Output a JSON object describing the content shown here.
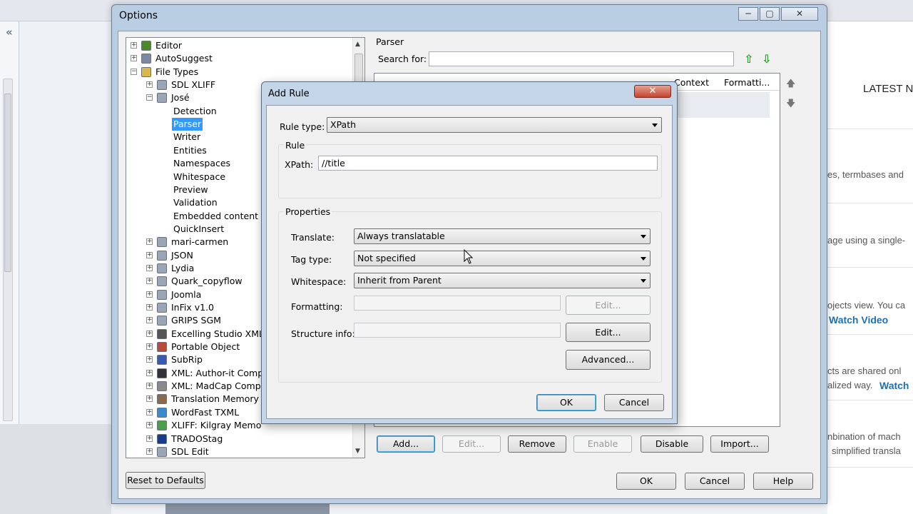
{
  "background": {
    "news_heading": "LATEST N",
    "news_items": [
      {
        "text": "es, termbases and",
        "link": ""
      },
      {
        "text": "age using a single-",
        "link": ""
      },
      {
        "text": "ojects view. You ca",
        "link": "Watch Video"
      },
      {
        "text": "cts are shared onl",
        "link": ""
      },
      {
        "text": "alized way.",
        "link": "Watch"
      },
      {
        "text": "nbination of mach",
        "link": ""
      },
      {
        "text": "simplified transla",
        "link": ""
      }
    ]
  },
  "options": {
    "title": "Options",
    "tree": [
      {
        "label": "Editor",
        "level": 0,
        "expander": "+",
        "icon": "pencil-icon",
        "color": "#4a8a2a"
      },
      {
        "label": "AutoSuggest",
        "level": 0,
        "expander": "+",
        "icon": "gears-icon",
        "color": "#7a8aa0"
      },
      {
        "label": "File Types",
        "level": 0,
        "expander": "-",
        "icon": "document-icon",
        "color": "#d8b84a"
      },
      {
        "label": "SDL XLIFF",
        "level": 1,
        "expander": "+",
        "icon": "document-icon",
        "color": "#9aa5b5"
      },
      {
        "label": "José",
        "level": 1,
        "expander": "-",
        "icon": "document-icon",
        "color": "#9aa5b5"
      },
      {
        "label": "Detection",
        "level": 2,
        "expander": "",
        "icon": "",
        "color": ""
      },
      {
        "label": "Parser",
        "level": 2,
        "expander": "",
        "icon": "",
        "color": "",
        "selected": true
      },
      {
        "label": "Writer",
        "level": 2,
        "expander": "",
        "icon": "",
        "color": ""
      },
      {
        "label": "Entities",
        "level": 2,
        "expander": "",
        "icon": "",
        "color": ""
      },
      {
        "label": "Namespaces",
        "level": 2,
        "expander": "",
        "icon": "",
        "color": ""
      },
      {
        "label": "Whitespace",
        "level": 2,
        "expander": "",
        "icon": "",
        "color": ""
      },
      {
        "label": "Preview",
        "level": 2,
        "expander": "",
        "icon": "",
        "color": ""
      },
      {
        "label": "Validation",
        "level": 2,
        "expander": "",
        "icon": "",
        "color": ""
      },
      {
        "label": "Embedded content",
        "level": 2,
        "expander": "",
        "icon": "",
        "color": ""
      },
      {
        "label": "QuickInsert",
        "level": 2,
        "expander": "",
        "icon": "",
        "color": ""
      },
      {
        "label": "mari-carmen",
        "level": 1,
        "expander": "+",
        "icon": "document-icon",
        "color": "#9aa5b5"
      },
      {
        "label": "JSON",
        "level": 1,
        "expander": "+",
        "icon": "document-icon",
        "color": "#9aa5b5"
      },
      {
        "label": "Lydia",
        "level": 1,
        "expander": "+",
        "icon": "document-icon",
        "color": "#9aa5b5"
      },
      {
        "label": "Quark_copyflow",
        "level": 1,
        "expander": "+",
        "icon": "document-icon",
        "color": "#9aa5b5"
      },
      {
        "label": "Joomla",
        "level": 1,
        "expander": "+",
        "icon": "document-icon",
        "color": "#9aa5b5"
      },
      {
        "label": "InFix v1.0",
        "level": 1,
        "expander": "+",
        "icon": "document-icon",
        "color": "#9aa5b5"
      },
      {
        "label": "GRIPS SGM",
        "level": 1,
        "expander": "+",
        "icon": "document-icon",
        "color": "#9aa5b5"
      },
      {
        "label": "Excelling Studio XML",
        "level": 1,
        "expander": "+",
        "icon": "xml-icon",
        "color": "#555"
      },
      {
        "label": "Portable Object",
        "level": 1,
        "expander": "+",
        "icon": "po-icon",
        "color": "#b84a3a"
      },
      {
        "label": "SubRip",
        "level": 1,
        "expander": "+",
        "icon": "subtitle-icon",
        "color": "#3a5ab0"
      },
      {
        "label": "XML: Author-it Compl",
        "level": 1,
        "expander": "+",
        "icon": "author-it-icon",
        "color": "#333"
      },
      {
        "label": "XML: MadCap Compli",
        "level": 1,
        "expander": "+",
        "icon": "madcap-icon",
        "color": "#8a8a8a"
      },
      {
        "label": "Translation Memory e",
        "level": 1,
        "expander": "+",
        "icon": "tm-icon",
        "color": "#8a6a4a"
      },
      {
        "label": "WordFast TXML",
        "level": 1,
        "expander": "+",
        "icon": "globe-icon",
        "color": "#3a8ad0"
      },
      {
        "label": "XLIFF: Kilgray Memo",
        "level": 1,
        "expander": "+",
        "icon": "kilgray-icon",
        "color": "#4aa04a"
      },
      {
        "label": "TRADOStag",
        "level": 1,
        "expander": "+",
        "icon": "tradostag-icon",
        "color": "#1a3a8a"
      },
      {
        "label": "SDL Edit",
        "level": 1,
        "expander": "+",
        "icon": "document-icon",
        "color": "#9aa5b5"
      }
    ],
    "parser_heading": "Parser",
    "search_label": "Search for:",
    "search_value": "",
    "columns": [
      "Context",
      "Formatti..."
    ],
    "buttons": {
      "add": "Add...",
      "edit": "Edit...",
      "remove": "Remove",
      "enable": "Enable",
      "disable": "Disable",
      "import": "Import...",
      "reset": "Reset to Defaults",
      "ok": "OK",
      "cancel": "Cancel",
      "help": "Help"
    }
  },
  "add_rule": {
    "title": "Add Rule",
    "close_glyph": "✕",
    "rule_type_label": "Rule type:",
    "rule_type_value": "XPath",
    "rule_group": "Rule",
    "xpath_label": "XPath:",
    "xpath_value": "//title",
    "properties_group": "Properties",
    "translate_label": "Translate:",
    "translate_value": "Always translatable",
    "tag_type_label": "Tag type:",
    "tag_type_value": "Not specified",
    "whitespace_label": "Whitespace:",
    "whitespace_value": "Inherit from Parent",
    "formatting_label": "Formatting:",
    "formatting_value": "",
    "structure_label": "Structure info:",
    "structure_value": "",
    "edit_formatting": "Edit...",
    "edit_structure": "Edit...",
    "advanced": "Advanced...",
    "ok": "OK",
    "cancel": "Cancel"
  }
}
